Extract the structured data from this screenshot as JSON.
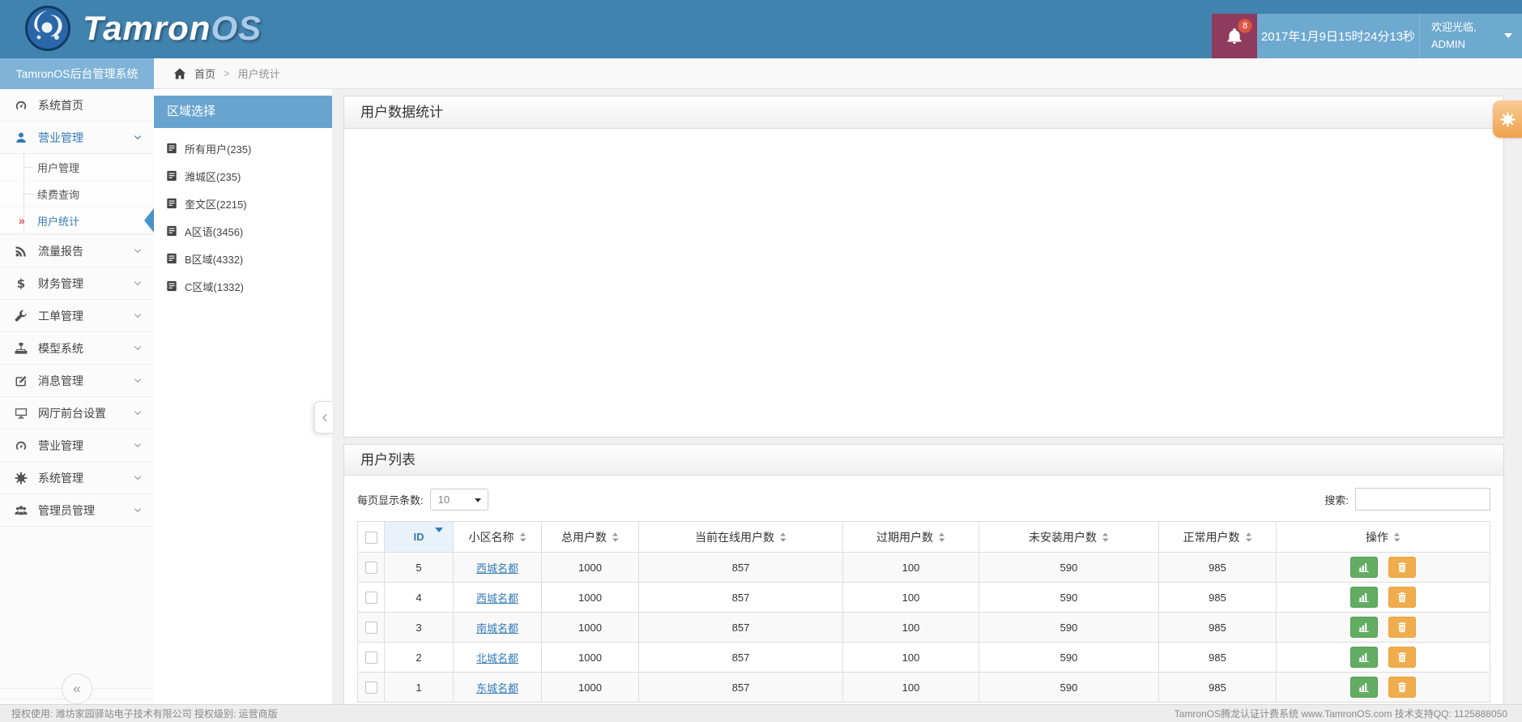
{
  "header": {
    "brand_primary": "Tamron",
    "brand_secondary": "OS",
    "notification_count": "8",
    "datetime": "2017年1月9日15时24分13秒",
    "welcome": "欢迎光临,",
    "username": "ADMIN"
  },
  "sidebar": {
    "title": "TamronOS后台管理系统",
    "active_marker": "»",
    "collapse_glyph": "«",
    "items": [
      {
        "label": "系统首页"
      },
      {
        "label": "营业管理",
        "children": [
          {
            "label": "用户管理"
          },
          {
            "label": "续费查询"
          },
          {
            "label": "用户统计"
          }
        ]
      },
      {
        "label": "流量报告"
      },
      {
        "label": "财务管理"
      },
      {
        "label": "工单管理"
      },
      {
        "label": "模型系统"
      },
      {
        "label": "消息管理"
      },
      {
        "label": "网厅前台设置"
      },
      {
        "label": "营业管理"
      },
      {
        "label": "系统管理"
      },
      {
        "label": "管理员管理"
      }
    ]
  },
  "breadcrumb": {
    "home": "首页",
    "separator": ">",
    "current": "用户统计"
  },
  "region_panel": {
    "title": "区域选择",
    "items": [
      {
        "label": "所有用户(235)",
        "icon_color": "#f08a24"
      },
      {
        "label": "潍城区(235)",
        "icon_color": "#cf6d9e"
      },
      {
        "label": "奎文区(2215)",
        "icon_color": "#cf6d9e"
      },
      {
        "label": "A区语(3456)",
        "icon_color": "#cf6d9e"
      },
      {
        "label": "B区域(4332)",
        "icon_color": "#cf6d9e"
      },
      {
        "label": "C区域(1332)",
        "icon_color": "#cf6d9e"
      }
    ]
  },
  "stats_panel": {
    "title": "用户数据统计"
  },
  "list_panel": {
    "title": "用户列表",
    "page_size_label": "每页显示条数:",
    "page_size_value": "10",
    "search_label": "搜索:",
    "search_value": "",
    "columns": [
      {
        "label": "ID"
      },
      {
        "label": "小区名称"
      },
      {
        "label": "总用户数"
      },
      {
        "label": "当前在线用户数"
      },
      {
        "label": "过期用户数"
      },
      {
        "label": "未安装用户数"
      },
      {
        "label": "正常用户数"
      },
      {
        "label": "操作"
      }
    ],
    "rows": [
      {
        "id": "5",
        "name": "西城名都",
        "total": "1000",
        "online": "857",
        "expired": "100",
        "not_installed": "590",
        "normal": "985"
      },
      {
        "id": "4",
        "name": "西城名都",
        "total": "1000",
        "online": "857",
        "expired": "100",
        "not_installed": "590",
        "normal": "985"
      },
      {
        "id": "3",
        "name": "南城名都",
        "total": "1000",
        "online": "857",
        "expired": "100",
        "not_installed": "590",
        "normal": "985"
      },
      {
        "id": "2",
        "name": "北城名都",
        "total": "1000",
        "online": "857",
        "expired": "100",
        "not_installed": "590",
        "normal": "985"
      },
      {
        "id": "1",
        "name": "东城名都",
        "total": "1000",
        "online": "857",
        "expired": "100",
        "not_installed": "590",
        "normal": "985"
      }
    ]
  },
  "footer": {
    "left": "授权使用: 潍坊家园驿站电子技术有限公司  授权级别: 运营商版",
    "right": "TamronOS腾龙认证计费系统 www.TamronOS.com 技术支持QQ: 1125888050"
  },
  "colors": {
    "header_blue": "#4183af",
    "header_light_blue": "#6ea9cf",
    "notification_maroon": "#8e3b5e",
    "badge_red": "#dd5745",
    "sidebar_title_blue": "#7fb3d7",
    "region_header_blue": "#69a4cf",
    "link_blue": "#337ab7",
    "active_marker_red": "#d9534f",
    "chart_button_green": "#63ad63",
    "delete_button_orange": "#f0ad4e",
    "gear_button_orange": "#f4b264",
    "region_icon_orange": "#f08a24",
    "region_icon_pink": "#cf6d9e",
    "id_column_bg": "#e9f2f9"
  }
}
